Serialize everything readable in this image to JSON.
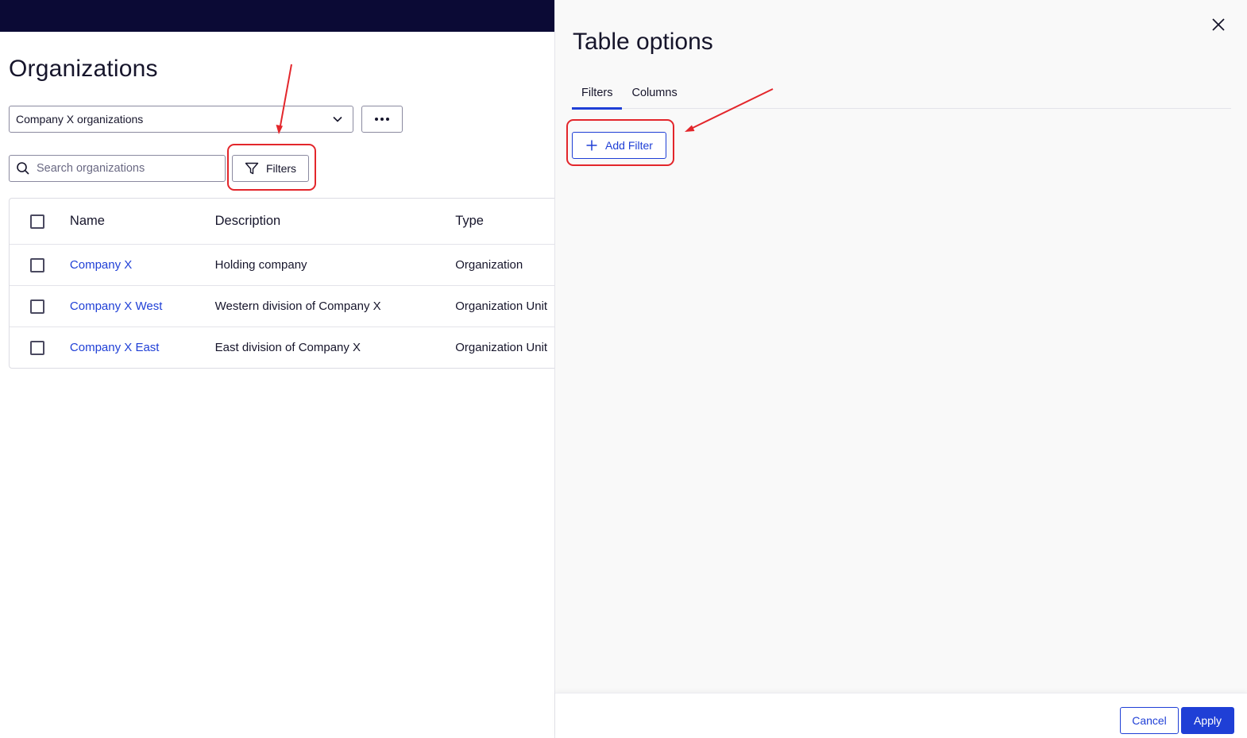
{
  "page": {
    "title": "Organizations",
    "org_select": {
      "value": "Company X organizations",
      "chevron_icon": "chevron-down-icon"
    },
    "more_button_icon": "ellipsis-icon",
    "search": {
      "placeholder": "Search organizations",
      "value": "",
      "icon": "search-icon"
    },
    "filters_button": {
      "label": "Filters",
      "icon": "funnel-icon"
    }
  },
  "table": {
    "columns": [
      "Name",
      "Description",
      "Type"
    ],
    "rows": [
      {
        "name": "Company X",
        "description": "Holding company",
        "type": "Organization",
        "checked": false
      },
      {
        "name": "Company X West",
        "description": "Western division of Company X",
        "type": "Organization Unit",
        "checked": false
      },
      {
        "name": "Company X East",
        "description": "East division of Company X",
        "type": "Organization Unit",
        "checked": false
      }
    ]
  },
  "panel": {
    "title": "Table options",
    "close_icon": "close-icon",
    "tabs": [
      {
        "label": "Filters",
        "active": true
      },
      {
        "label": "Columns",
        "active": false
      }
    ],
    "add_filter": {
      "label": "Add Filter",
      "icon": "plus-icon"
    },
    "footer": {
      "cancel_label": "Cancel",
      "apply_label": "Apply"
    }
  },
  "colors": {
    "topbar": "#0b0a35",
    "primary": "#1f3fd6",
    "text": "#16152b",
    "annotation": "#e3262b",
    "panel_bg": "#f9f9f9"
  }
}
